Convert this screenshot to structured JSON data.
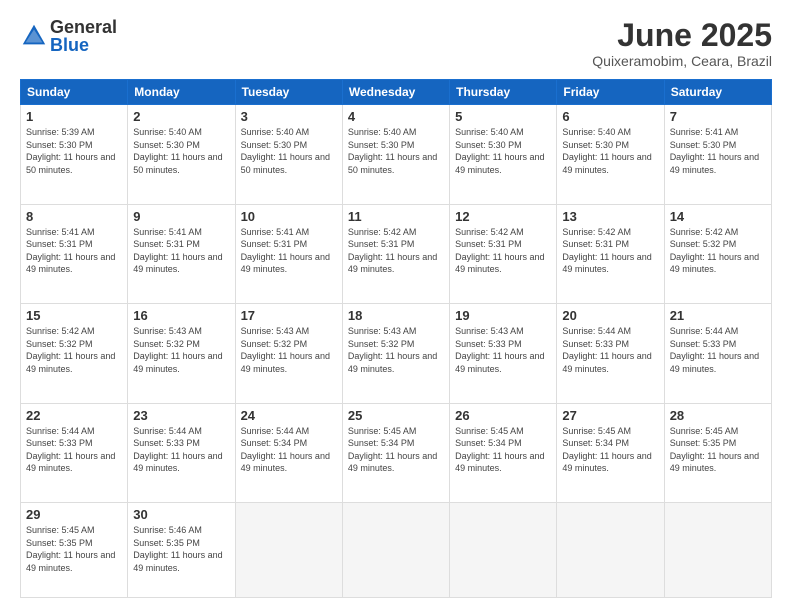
{
  "header": {
    "logo_general": "General",
    "logo_blue": "Blue",
    "month_title": "June 2025",
    "location": "Quixeramobim, Ceara, Brazil"
  },
  "weekdays": [
    "Sunday",
    "Monday",
    "Tuesday",
    "Wednesday",
    "Thursday",
    "Friday",
    "Saturday"
  ],
  "weeks": [
    [
      {
        "day": "1",
        "sunrise": "5:39 AM",
        "sunset": "5:30 PM",
        "daylight": "11 hours and 50 minutes."
      },
      {
        "day": "2",
        "sunrise": "5:40 AM",
        "sunset": "5:30 PM",
        "daylight": "11 hours and 50 minutes."
      },
      {
        "day": "3",
        "sunrise": "5:40 AM",
        "sunset": "5:30 PM",
        "daylight": "11 hours and 50 minutes."
      },
      {
        "day": "4",
        "sunrise": "5:40 AM",
        "sunset": "5:30 PM",
        "daylight": "11 hours and 50 minutes."
      },
      {
        "day": "5",
        "sunrise": "5:40 AM",
        "sunset": "5:30 PM",
        "daylight": "11 hours and 49 minutes."
      },
      {
        "day": "6",
        "sunrise": "5:40 AM",
        "sunset": "5:30 PM",
        "daylight": "11 hours and 49 minutes."
      },
      {
        "day": "7",
        "sunrise": "5:41 AM",
        "sunset": "5:30 PM",
        "daylight": "11 hours and 49 minutes."
      }
    ],
    [
      {
        "day": "8",
        "sunrise": "5:41 AM",
        "sunset": "5:31 PM",
        "daylight": "11 hours and 49 minutes."
      },
      {
        "day": "9",
        "sunrise": "5:41 AM",
        "sunset": "5:31 PM",
        "daylight": "11 hours and 49 minutes."
      },
      {
        "day": "10",
        "sunrise": "5:41 AM",
        "sunset": "5:31 PM",
        "daylight": "11 hours and 49 minutes."
      },
      {
        "day": "11",
        "sunrise": "5:42 AM",
        "sunset": "5:31 PM",
        "daylight": "11 hours and 49 minutes."
      },
      {
        "day": "12",
        "sunrise": "5:42 AM",
        "sunset": "5:31 PM",
        "daylight": "11 hours and 49 minutes."
      },
      {
        "day": "13",
        "sunrise": "5:42 AM",
        "sunset": "5:31 PM",
        "daylight": "11 hours and 49 minutes."
      },
      {
        "day": "14",
        "sunrise": "5:42 AM",
        "sunset": "5:32 PM",
        "daylight": "11 hours and 49 minutes."
      }
    ],
    [
      {
        "day": "15",
        "sunrise": "5:42 AM",
        "sunset": "5:32 PM",
        "daylight": "11 hours and 49 minutes."
      },
      {
        "day": "16",
        "sunrise": "5:43 AM",
        "sunset": "5:32 PM",
        "daylight": "11 hours and 49 minutes."
      },
      {
        "day": "17",
        "sunrise": "5:43 AM",
        "sunset": "5:32 PM",
        "daylight": "11 hours and 49 minutes."
      },
      {
        "day": "18",
        "sunrise": "5:43 AM",
        "sunset": "5:32 PM",
        "daylight": "11 hours and 49 minutes."
      },
      {
        "day": "19",
        "sunrise": "5:43 AM",
        "sunset": "5:33 PM",
        "daylight": "11 hours and 49 minutes."
      },
      {
        "day": "20",
        "sunrise": "5:44 AM",
        "sunset": "5:33 PM",
        "daylight": "11 hours and 49 minutes."
      },
      {
        "day": "21",
        "sunrise": "5:44 AM",
        "sunset": "5:33 PM",
        "daylight": "11 hours and 49 minutes."
      }
    ],
    [
      {
        "day": "22",
        "sunrise": "5:44 AM",
        "sunset": "5:33 PM",
        "daylight": "11 hours and 49 minutes."
      },
      {
        "day": "23",
        "sunrise": "5:44 AM",
        "sunset": "5:33 PM",
        "daylight": "11 hours and 49 minutes."
      },
      {
        "day": "24",
        "sunrise": "5:44 AM",
        "sunset": "5:34 PM",
        "daylight": "11 hours and 49 minutes."
      },
      {
        "day": "25",
        "sunrise": "5:45 AM",
        "sunset": "5:34 PM",
        "daylight": "11 hours and 49 minutes."
      },
      {
        "day": "26",
        "sunrise": "5:45 AM",
        "sunset": "5:34 PM",
        "daylight": "11 hours and 49 minutes."
      },
      {
        "day": "27",
        "sunrise": "5:45 AM",
        "sunset": "5:34 PM",
        "daylight": "11 hours and 49 minutes."
      },
      {
        "day": "28",
        "sunrise": "5:45 AM",
        "sunset": "5:35 PM",
        "daylight": "11 hours and 49 minutes."
      }
    ],
    [
      {
        "day": "29",
        "sunrise": "5:45 AM",
        "sunset": "5:35 PM",
        "daylight": "11 hours and 49 minutes."
      },
      {
        "day": "30",
        "sunrise": "5:46 AM",
        "sunset": "5:35 PM",
        "daylight": "11 hours and 49 minutes."
      },
      null,
      null,
      null,
      null,
      null
    ]
  ]
}
